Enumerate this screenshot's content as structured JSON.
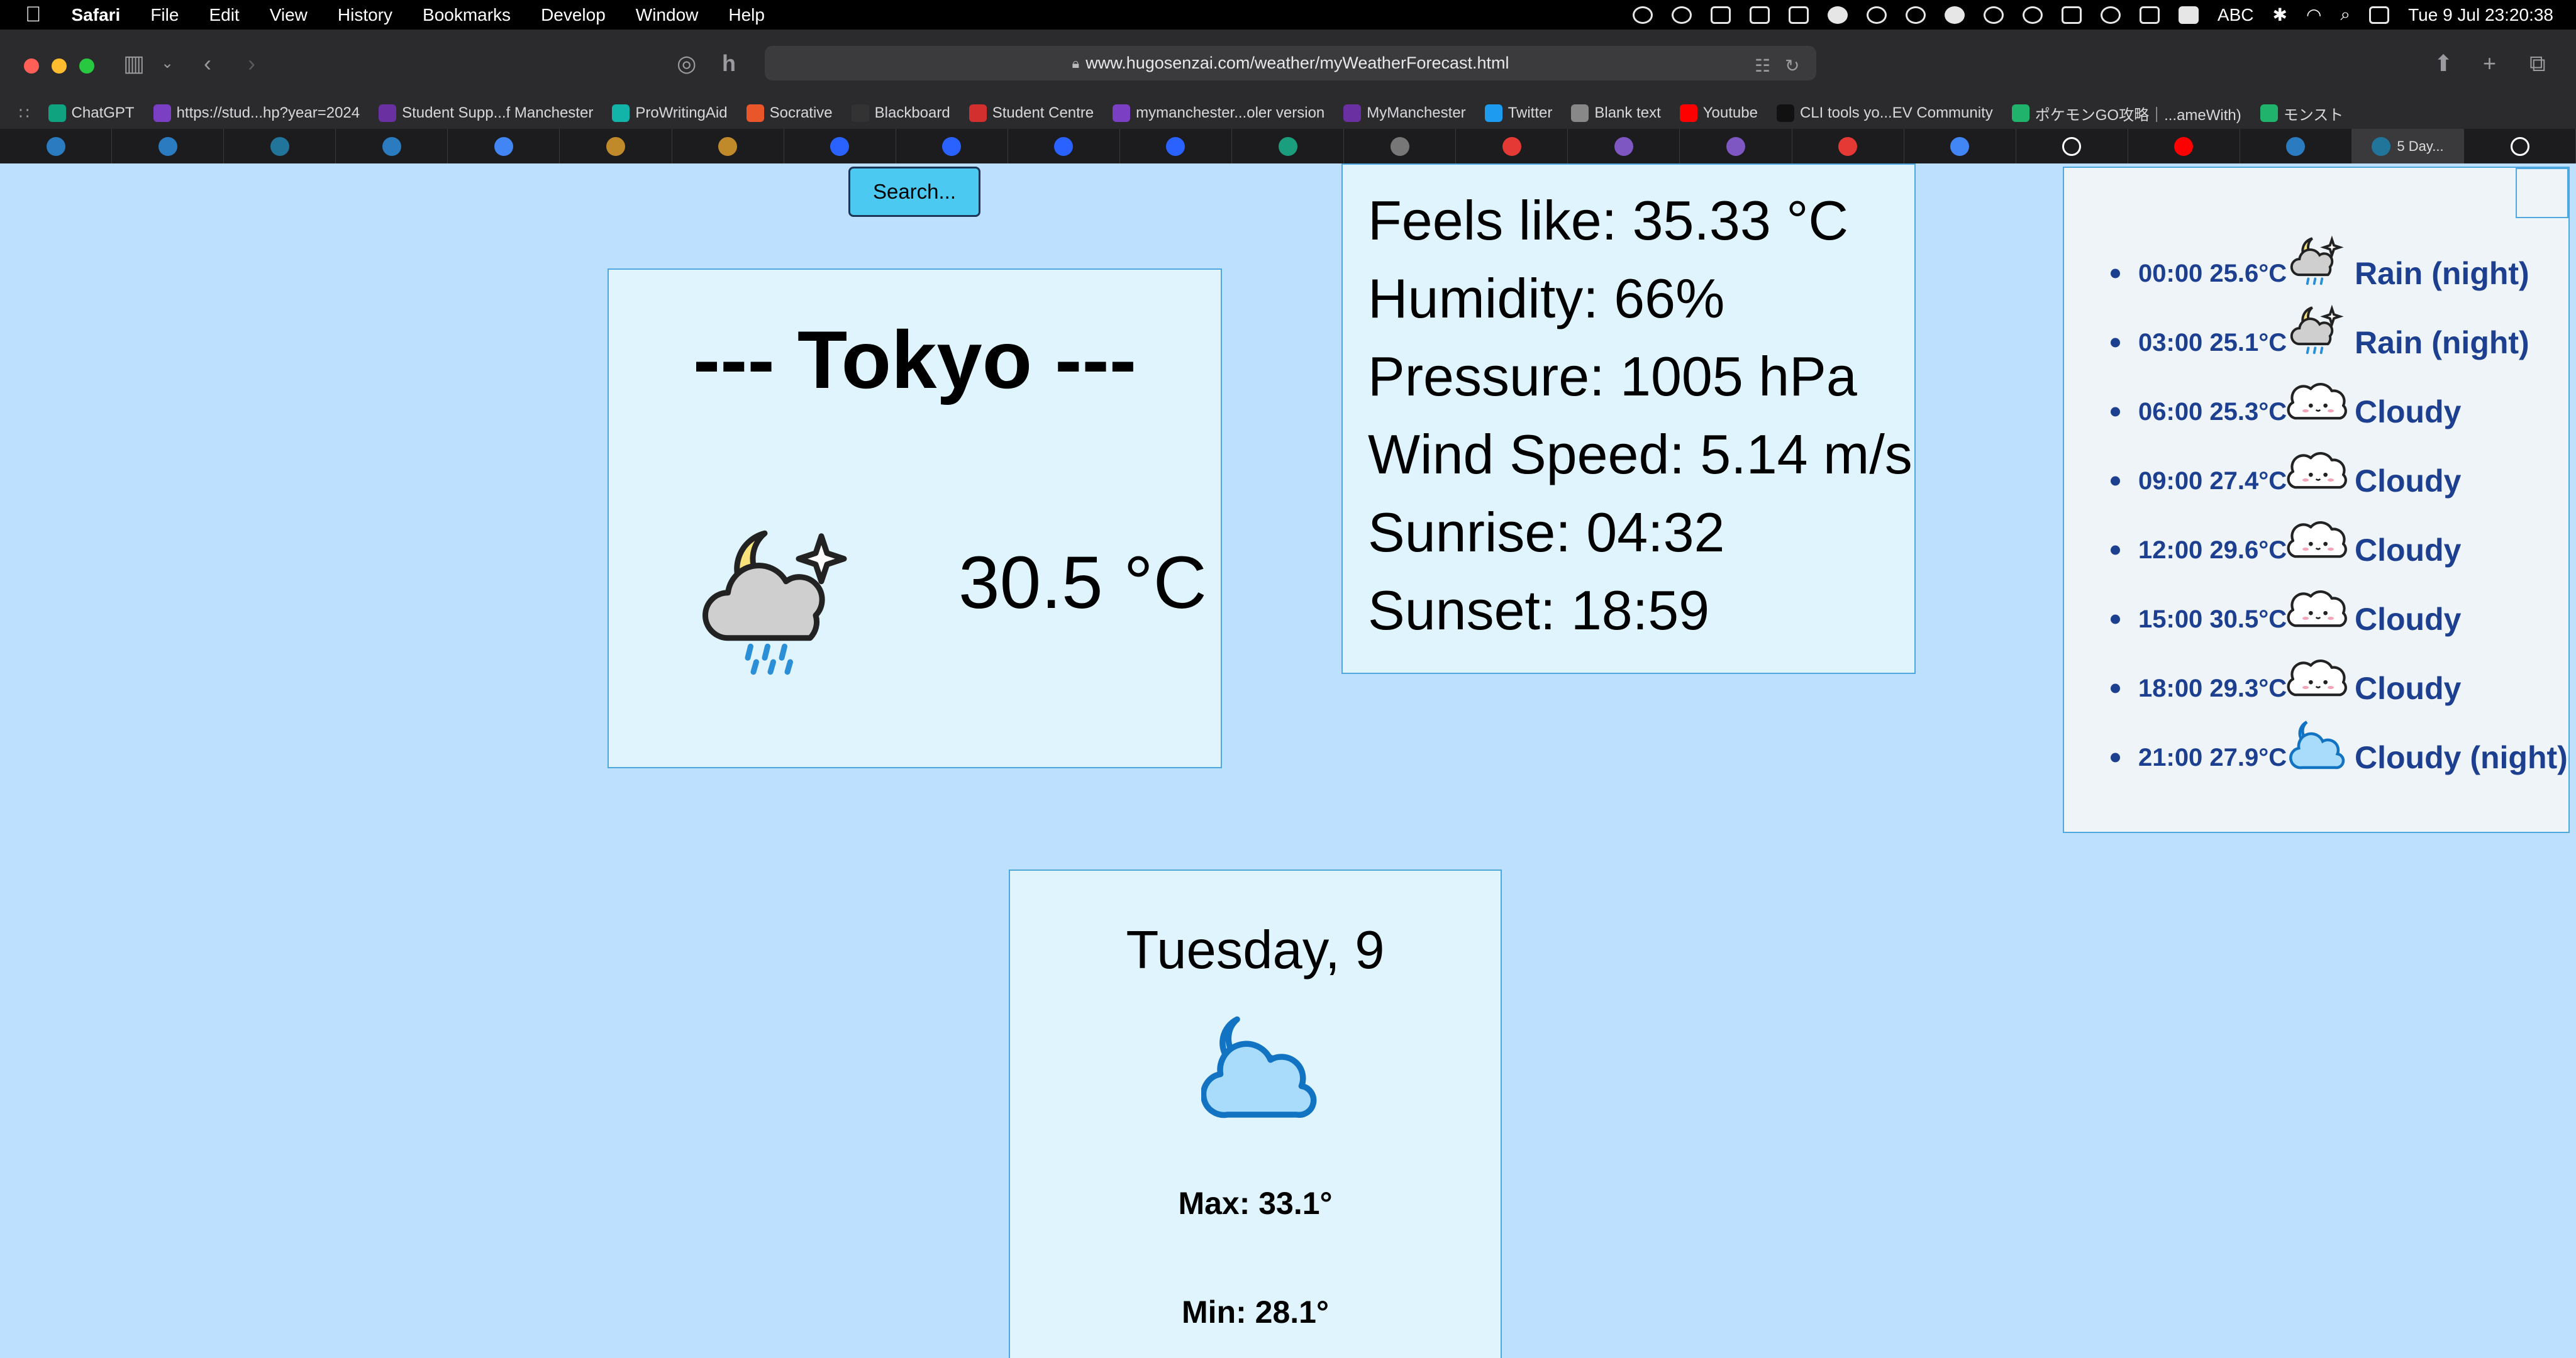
{
  "menubar": {
    "app": "Safari",
    "items": [
      "File",
      "Edit",
      "View",
      "History",
      "Bookmarks",
      "Develop",
      "Window",
      "Help"
    ],
    "input_source": "ABC",
    "datetime": "Tue 9 Jul  23:20:38"
  },
  "browser": {
    "url": "www.hugosenzai.com/weather/myWeatherForecast.html",
    "favorites": [
      {
        "label": "ChatGPT",
        "icon": "chatgpt-icon",
        "color": "#10a37f"
      },
      {
        "label": "https://stud...hp?year=2024",
        "icon": "m-icon",
        "color": "#7b3fc4"
      },
      {
        "label": "Student Supp...f Manchester",
        "icon": "my-icon",
        "color": "#6a2fa0"
      },
      {
        "label": "ProWritingAid",
        "icon": "prowritingaid-icon",
        "color": "#12b3a8"
      },
      {
        "label": "Socrative",
        "icon": "socrative-icon",
        "color": "#e8562a"
      },
      {
        "label": "Blackboard",
        "icon": "blackboard-icon",
        "color": "#333333"
      },
      {
        "label": "Student Centre",
        "icon": "student-centre-icon",
        "color": "#d32f2f"
      },
      {
        "label": "mymanchester...oler version",
        "icon": "m-icon",
        "color": "#7b3fc4"
      },
      {
        "label": "MyManchester",
        "icon": "my-icon",
        "color": "#6a2fa0"
      },
      {
        "label": "Twitter",
        "icon": "twitter-icon",
        "color": "#1d9bf0"
      },
      {
        "label": "Blank text",
        "icon": "blank-text-icon",
        "color": "#888888"
      },
      {
        "label": "Youtube",
        "icon": "youtube-icon",
        "color": "#ff0000"
      },
      {
        "label": "CLI tools yo...EV Community",
        "icon": "dev-icon",
        "color": "#111111"
      },
      {
        "label": "ポケモンGO攻略｜...ameWith)",
        "icon": "gamewith-icon",
        "color": "#1fb36b"
      },
      {
        "label": "モンスト",
        "icon": "gamewith-icon",
        "color": "#1fb36b"
      }
    ],
    "tabs": [
      {
        "icon": "app-icon",
        "color": "#2a7bbf",
        "label": ""
      },
      {
        "icon": "app-icon",
        "color": "#2a7bbf",
        "label": ""
      },
      {
        "icon": "wordpress-icon",
        "color": "#21759b",
        "label": ""
      },
      {
        "icon": "app-icon",
        "color": "#2a7bbf",
        "label": ""
      },
      {
        "icon": "google-icon",
        "color": "#4285f4",
        "label": ""
      },
      {
        "icon": "lightning-icon",
        "color": "#c08a2b",
        "label": ""
      },
      {
        "icon": "lightning-icon",
        "color": "#c08a2b",
        "label": ""
      },
      {
        "icon": "c-icon",
        "color": "#2962ff",
        "label": ""
      },
      {
        "icon": "c-icon",
        "color": "#2962ff",
        "label": ""
      },
      {
        "icon": "c-icon",
        "color": "#2962ff",
        "label": ""
      },
      {
        "icon": "c-icon",
        "color": "#2962ff",
        "label": ""
      },
      {
        "icon": "xl-icon",
        "color": "#1a9e7e",
        "label": ""
      },
      {
        "icon": "s-icon",
        "color": "#777777",
        "label": ""
      },
      {
        "icon": "compass-icon",
        "color": "#e53935",
        "label": ""
      },
      {
        "icon": "brush-icon",
        "color": "#7e57c2",
        "label": ""
      },
      {
        "icon": "brush-icon",
        "color": "#7e57c2",
        "label": ""
      },
      {
        "icon": "tools-icon",
        "color": "#e53935",
        "label": ""
      },
      {
        "icon": "google-icon",
        "color": "#4285f4",
        "label": ""
      },
      {
        "icon": "github-icon",
        "color": "#ffffff",
        "label": ""
      },
      {
        "icon": "youtube-icon",
        "color": "#ff0000",
        "label": ""
      },
      {
        "icon": "app-icon",
        "color": "#2a7bbf",
        "label": ""
      },
      {
        "icon": "wordpress-icon",
        "color": "#21759b",
        "label": "5 Day..."
      },
      {
        "icon": "github-icon",
        "color": "#ffffff",
        "label": ""
      }
    ],
    "active_tab": 21
  },
  "page": {
    "search_label": "Search...",
    "current": {
      "city": "--- Tokyo ---",
      "temperature": "30.5 °C",
      "icon": "rain-night-icon"
    },
    "details": [
      "Feels like: 35.33 °C",
      "Humidity: 66%",
      "Pressure: 1005 hPa",
      "Wind Speed: 5.14 m/s",
      "Sunrise: 04:32",
      "Sunset: 18:59"
    ],
    "hourly": [
      {
        "time": "00:00 25.6°C",
        "condition": "Rain (night)",
        "icon": "rain-night-icon"
      },
      {
        "time": "03:00 25.1°C",
        "condition": "Rain (night)",
        "icon": "rain-night-icon"
      },
      {
        "time": "06:00 25.3°C",
        "condition": "Cloudy",
        "icon": "cute-cloud-icon"
      },
      {
        "time": "09:00 27.4°C",
        "condition": "Cloudy",
        "icon": "cute-cloud-icon"
      },
      {
        "time": "12:00 29.6°C",
        "condition": "Cloudy",
        "icon": "cute-cloud-icon"
      },
      {
        "time": "15:00 30.5°C",
        "condition": "Cloudy",
        "icon": "cute-cloud-icon"
      },
      {
        "time": "18:00 29.3°C",
        "condition": "Cloudy",
        "icon": "cute-cloud-icon"
      },
      {
        "time": "21:00 27.9°C",
        "condition": "Cloudy (night)",
        "icon": "cloudy-night-icon"
      }
    ],
    "daily": {
      "day": "Tuesday, 9",
      "icon": "cloudy-night-icon",
      "max": "Max: 33.1°",
      "min": "Min: 28.1°"
    }
  }
}
